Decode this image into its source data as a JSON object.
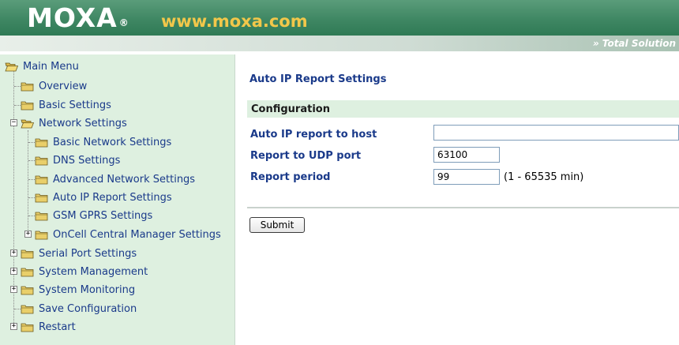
{
  "header": {
    "logo_text": "MOXA",
    "logo_reg": "®",
    "logo_url": "www.moxa.com",
    "tagline": "» Total Solution"
  },
  "sidebar": {
    "root": "Main Menu",
    "items": {
      "overview": "Overview",
      "basic_settings": "Basic Settings",
      "network_settings": "Network Settings",
      "basic_network_settings": "Basic Network Settings",
      "dns_settings": "DNS Settings",
      "advanced_network_settings": "Advanced Network Settings",
      "auto_ip_report_settings": "Auto IP Report Settings",
      "gsm_gprs_settings": "GSM GPRS Settings",
      "oncell_central_manager_settings": "OnCell Central Manager Settings",
      "serial_port_settings": "Serial Port Settings",
      "system_management": "System Management",
      "system_monitoring": "System Monitoring",
      "save_configuration": "Save Configuration",
      "restart": "Restart"
    }
  },
  "main": {
    "title": "Auto IP Report Settings",
    "config_header": "Configuration",
    "fields": {
      "host_label": "Auto IP report to host",
      "host_value": "",
      "udp_label": "Report to UDP port",
      "udp_value": "63100",
      "period_label": "Report period",
      "period_value": "99",
      "period_hint": "(1 - 65535 min)"
    },
    "submit_label": "Submit"
  },
  "colors": {
    "header_green": "#3f8763",
    "url_yellow": "#f2c74a",
    "sidebar_bg": "#def0e0",
    "text_blue": "#1a3a8a"
  }
}
